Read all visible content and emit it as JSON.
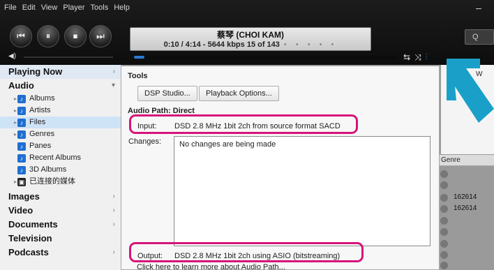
{
  "menu": [
    "File",
    "Edit",
    "View",
    "Player",
    "Tools",
    "Help"
  ],
  "transport": {
    "prev": "⏮",
    "pause": "⏸",
    "stop": "⏹",
    "next": "⏭"
  },
  "now_playing": {
    "artist": "蔡琴 (CHOI KAM)",
    "info": "0:10 / 4:14 - 5644 kbps   15 of 143",
    "dots": "• • • • •"
  },
  "search": {
    "icon": "Q"
  },
  "progress_fraction": 0.04,
  "sidebar": {
    "sections": [
      {
        "label": "Playing Now",
        "caret": "›"
      },
      {
        "label": "Audio",
        "caret": "▾"
      },
      {
        "label": "Images",
        "caret": "›"
      },
      {
        "label": "Video",
        "caret": "›"
      },
      {
        "label": "Documents",
        "caret": "›"
      },
      {
        "label": "Television",
        "caret": ""
      },
      {
        "label": "Podcasts",
        "caret": "›"
      }
    ],
    "audio_items": [
      {
        "label": "Albums"
      },
      {
        "label": "Artists"
      },
      {
        "label": "Files"
      },
      {
        "label": "Genres"
      },
      {
        "label": "Panes"
      },
      {
        "label": "Recent Albums"
      },
      {
        "label": "3D Albums"
      },
      {
        "label": "已连接的媒体"
      }
    ]
  },
  "dialog": {
    "title": "Tools",
    "buttons": [
      "DSP Studio...",
      "Playback Options..."
    ],
    "audio_path": "Audio Path: Direct",
    "input_label": "Input:",
    "input_value": "DSD 2.8 MHz 1bit 2ch from source format SACD",
    "changes_label": "Changes:",
    "changes_value": "No changes are being made",
    "output_label": "Output:",
    "output_value": "DSD 2.8 MHz 1bit 2ch using ASIO (bitstreaming)",
    "learn_more": "Click here to learn more about Audio Path..."
  },
  "background": {
    "genre_header": "Genre",
    "nums": [
      "162614",
      "162614"
    ],
    "right_letter": "W"
  },
  "colors": {
    "highlight": "#d6147a",
    "arrow": "#1aa0c8",
    "accent": "#2b7bd1"
  }
}
